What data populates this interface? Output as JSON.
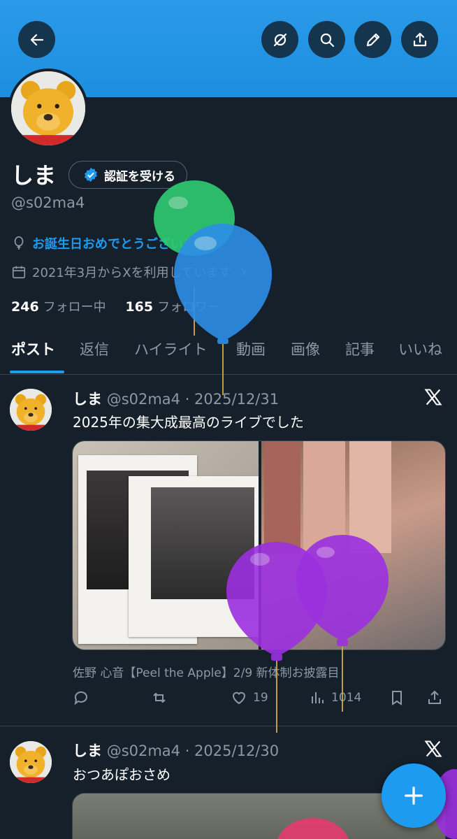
{
  "colors": {
    "accent": "#1d9bf0",
    "banner": "#2a9ae8",
    "background": "#15202b",
    "muted": "#8b98a5"
  },
  "header": {
    "icons": [
      "back-arrow-icon",
      "grok-icon",
      "search-icon",
      "edit-pencil-icon",
      "share-upload-icon"
    ]
  },
  "profile": {
    "name": "しま",
    "verify_label": "認証を受ける",
    "handle": "@s02ma4",
    "birthday": "お誕生日おめでとうございます。",
    "joined": "2021年3月からXを利用しています",
    "following_count": "246",
    "following_label": "フォロー中",
    "followers_count": "165",
    "followers_label": "フォロワー"
  },
  "tabs": [
    "ポスト",
    "返信",
    "ハイライト",
    "動画",
    "画像",
    "記事",
    "いいね"
  ],
  "posts": [
    {
      "name": "しま",
      "handle_date": "@s02ma4 · 2025/12/31",
      "text": "2025年の集大成最高のライブでした",
      "caption": "佐野 心音【Peel the Apple】2/9 新体制お披露目",
      "likes": "19",
      "views": "1014"
    },
    {
      "name": "しま",
      "handle_date": "@s02ma4 · 2025/12/30",
      "text": "おつあぽおさめ"
    }
  ],
  "fab": {
    "label": "+"
  }
}
